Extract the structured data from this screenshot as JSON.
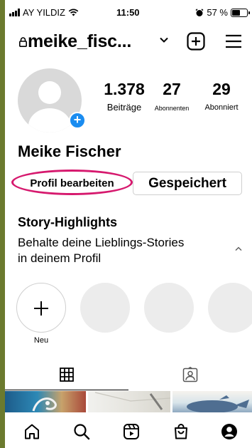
{
  "status_bar": {
    "carrier": "AY YILDIZ",
    "time": "11:50",
    "battery_percent": "57 %",
    "battery_level": 0.57
  },
  "header": {
    "username": "meike_fisc...",
    "icons": [
      "lock-icon",
      "chevron-down-icon",
      "create-post-icon",
      "menu-icon"
    ]
  },
  "profile": {
    "stats": {
      "posts": {
        "value": "1.378",
        "label": "Beiträge"
      },
      "followers": {
        "value": "27",
        "label": "Abonnenten"
      },
      "following": {
        "value": "29",
        "label": "Abonniert"
      }
    },
    "full_name": "Meike Fischer",
    "buttons": {
      "edit_profile": "Profil bearbeiten",
      "saved": "Gespeichert"
    },
    "highlight_accent": "#d6196e"
  },
  "story_highlights": {
    "title": "Story-Highlights",
    "description": "Behalte deine Lieblings-Stories in deinem Profil",
    "new_label": "Neu"
  },
  "tabs": [
    {
      "icon": "grid-icon",
      "active": true
    },
    {
      "icon": "tagged-icon",
      "active": false
    }
  ],
  "bottom_nav": [
    "home-icon",
    "search-icon",
    "reels-icon",
    "shop-icon",
    "profile-icon"
  ],
  "colors": {
    "add_badge": "#1a8cf0",
    "text": "#000000",
    "placeholder": "#ececec"
  }
}
